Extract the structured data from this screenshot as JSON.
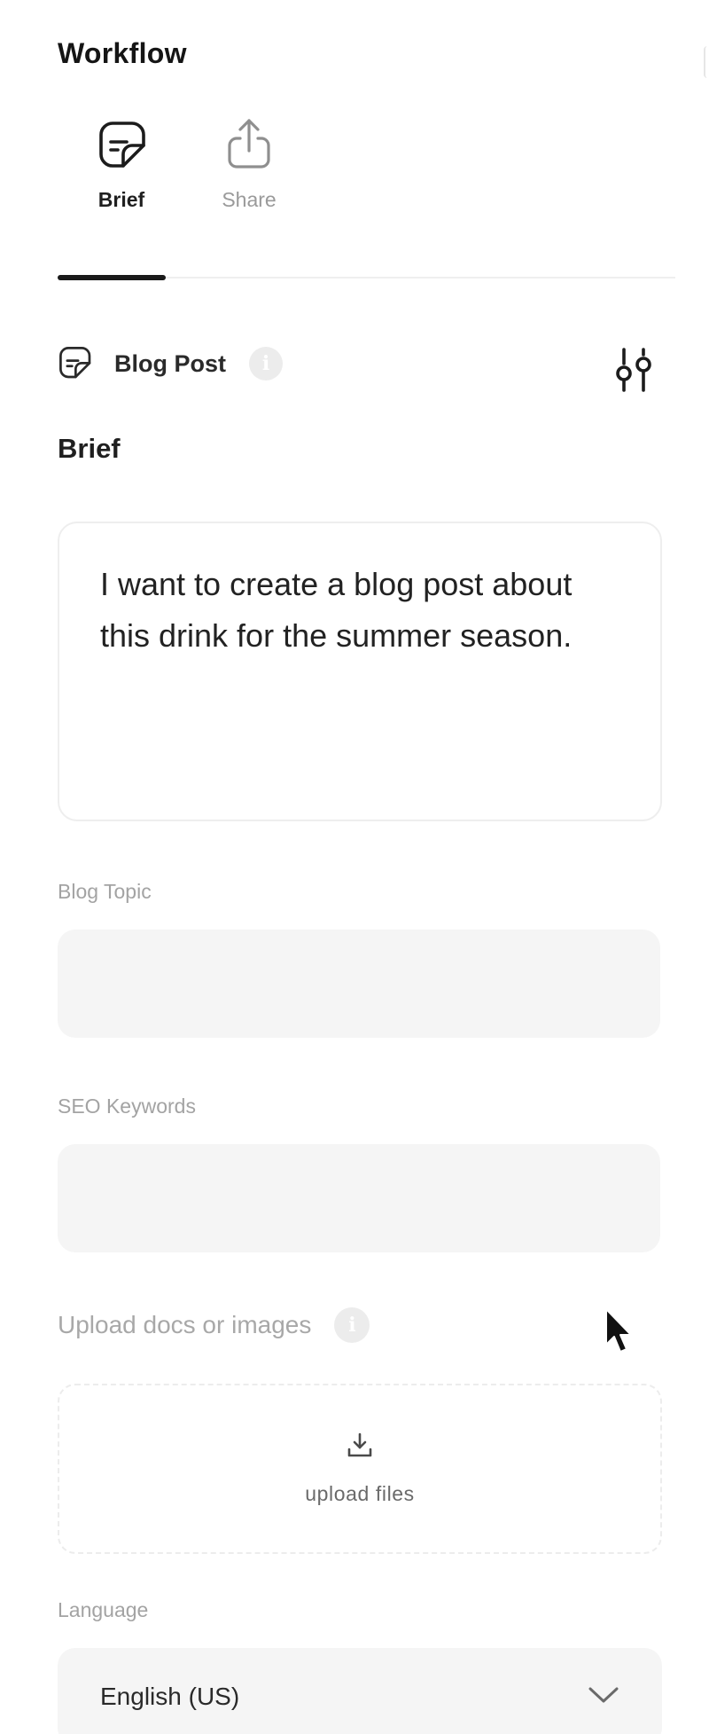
{
  "panel": {
    "title": "Workflow"
  },
  "tabs": [
    {
      "label": "Brief",
      "icon": "document-icon",
      "active": true
    },
    {
      "label": "Share",
      "icon": "share-icon",
      "active": false
    }
  ],
  "doc_type": {
    "label": "Blog Post",
    "icon": "document-icon",
    "info_icon": "info-icon"
  },
  "brief": {
    "heading": "Brief",
    "value": "I want to create a blog post about this drink for the summer season."
  },
  "blog_topic": {
    "label": "Blog Topic",
    "value": ""
  },
  "seo_keywords": {
    "label": "SEO Keywords",
    "value": ""
  },
  "upload": {
    "label": "Upload docs or images",
    "button_label": "upload files",
    "icon": "download-tray-icon",
    "info_icon": "info-icon"
  },
  "language": {
    "label": "Language",
    "selected": "English (US)",
    "icon": "chevron-down-icon"
  },
  "settings": {
    "icon": "sliders-icon"
  },
  "colors": {
    "text": "#1a1a1a",
    "muted": "#a3a3a3",
    "input_bg": "#f5f5f5",
    "border": "#eeeeee"
  }
}
